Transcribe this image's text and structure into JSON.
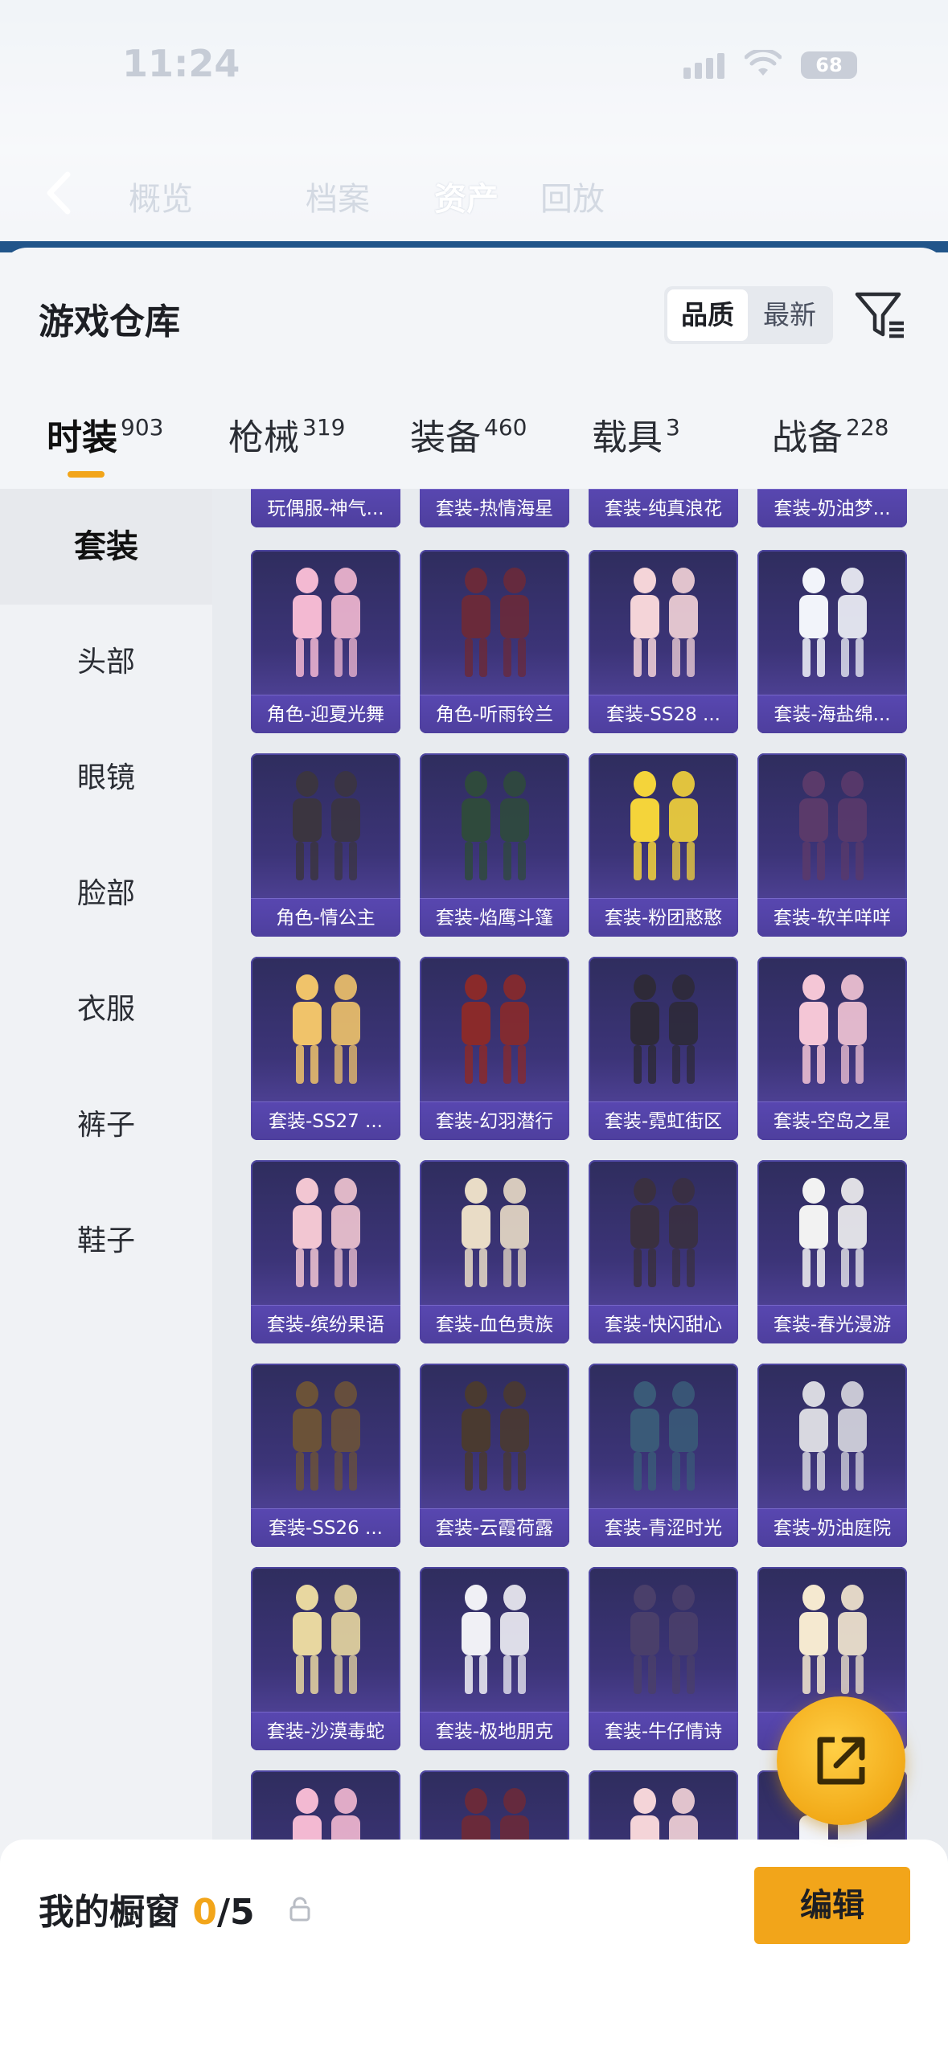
{
  "status_bar": {
    "time": "11:24",
    "battery": "68"
  },
  "top_nav": {
    "tabs": [
      {
        "label": "概览",
        "active": false
      },
      {
        "label": "档案",
        "active": false
      },
      {
        "label": "资产",
        "active": true
      },
      {
        "label": "回放",
        "active": false
      }
    ]
  },
  "panel": {
    "title": "游戏仓库",
    "sort": {
      "options": [
        "品质",
        "最新"
      ],
      "selected": "品质"
    },
    "category_tabs": [
      {
        "label": "时装",
        "count": "903",
        "active": true
      },
      {
        "label": "枪械",
        "count": "319",
        "active": false
      },
      {
        "label": "装备",
        "count": "460",
        "active": false
      },
      {
        "label": "载具",
        "count": "3",
        "active": false
      },
      {
        "label": "战备",
        "count": "228",
        "active": false
      }
    ],
    "sidebar": [
      {
        "label": "套装",
        "active": true
      },
      {
        "label": "头部",
        "active": false
      },
      {
        "label": "眼镜",
        "active": false
      },
      {
        "label": "脸部",
        "active": false
      },
      {
        "label": "衣服",
        "active": false
      },
      {
        "label": "裤子",
        "active": false
      },
      {
        "label": "鞋子",
        "active": false
      }
    ],
    "items": [
      "玩偶服-神气...",
      "套装-热情海星",
      "套装-纯真浪花",
      "套装-奶油梦...",
      "角色-迎夏光舞",
      "角色-听雨铃兰",
      "套装-SS28 ...",
      "套装-海盐绵...",
      "角色-情公主",
      "套装-焰鹰斗篷",
      "套装-粉团憨憨",
      "套装-软羊咩咩",
      "套装-SS27 ...",
      "套装-幻羽潜行",
      "套装-霓虹街区",
      "套装-空岛之星",
      "套装-缤纷果语",
      "套装-血色贵族",
      "套装-快闪甜心",
      "套装-春光漫游",
      "套装-SS26 ...",
      "套装-云霞荷露",
      "套装-青涩时光",
      "套装-奶油庭院",
      "套装-沙漠毒蛇",
      "套装-极地朋克",
      "套装-牛仔情诗",
      "套装-",
      "",
      "",
      "",
      ""
    ]
  },
  "bottom": {
    "title": "我的橱窗",
    "current": "0",
    "max": "/5",
    "edit_label": "编辑"
  },
  "colors": {
    "accent": "#f2a51a",
    "card": "#3c3478",
    "label_bar": "#5847b0"
  }
}
